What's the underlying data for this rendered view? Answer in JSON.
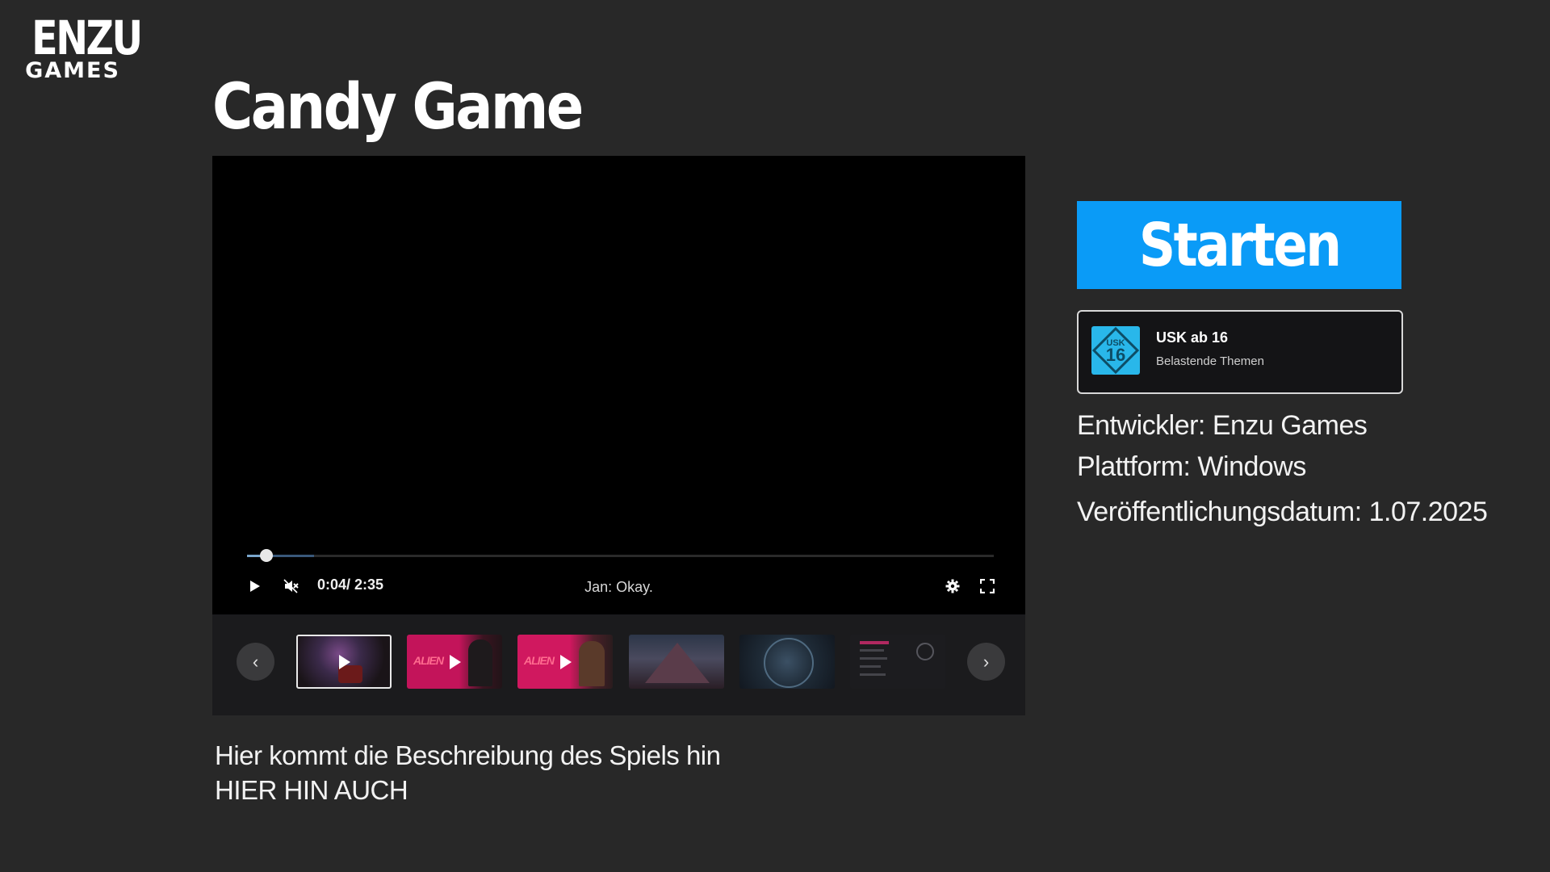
{
  "brand": {
    "logo_top": "ENZU",
    "logo_bottom": "GAMES"
  },
  "game": {
    "title": "Candy Game"
  },
  "player": {
    "current_time": "0:04",
    "duration": "2:35",
    "time_display": "0:04/ 2:35",
    "progress_fraction": 0.026,
    "buffered_fraction": 0.09,
    "subtitle": "Jan: Okay.",
    "muted": true,
    "icons": {
      "play": "play-icon",
      "mute": "volume-muted-icon",
      "settings": "gear-icon",
      "fullscreen": "fullscreen-icon"
    }
  },
  "gallery": {
    "prev_label": "‹",
    "next_label": "›",
    "thumbnails": [
      {
        "kind": "video",
        "active": true
      },
      {
        "kind": "video",
        "text": "ALIEN"
      },
      {
        "kind": "video",
        "text": "ALIEN"
      },
      {
        "kind": "image"
      },
      {
        "kind": "image"
      },
      {
        "kind": "image"
      }
    ]
  },
  "description": {
    "line1": "Hier kommt die Beschreibung des Spiels hin",
    "line2": "HIER HIN AUCH"
  },
  "sidebar": {
    "start_label": "Starten",
    "rating": {
      "badge_text": "USK",
      "badge_number": "16",
      "title": "USK ab 16",
      "descriptor": "Belastende Themen",
      "badge_color": "#29b7ea"
    },
    "developer": "Entwickler: Enzu Games",
    "platform": "Plattform: Windows",
    "release": "Veröffentlichungsdatum: 1.07.2025"
  },
  "colors": {
    "background": "#282828",
    "accent": "#0a9bf7",
    "player": "#000000",
    "thumbstrip": "#1b1b1d"
  }
}
